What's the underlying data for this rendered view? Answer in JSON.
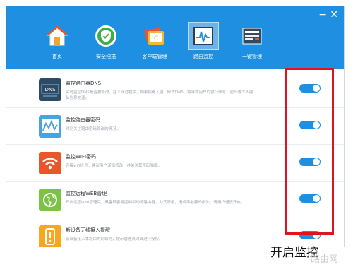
{
  "window_controls": {
    "minimize": "−",
    "close": "✕"
  },
  "nav": [
    {
      "label": "首页",
      "icon": "home-icon"
    },
    {
      "label": "安全扫描",
      "icon": "shield-icon"
    },
    {
      "label": "客户端管理",
      "icon": "client-manage-icon"
    },
    {
      "label": "路由监控",
      "icon": "router-monitor-icon"
    },
    {
      "label": "一键管理",
      "icon": "one-key-manage-icon"
    }
  ],
  "rows": [
    {
      "title": "监控路由器DNS",
      "desc": "实时监控DNS是否被修改，在上网过程中，如果病毒入侵，修改DNS，将导致用户的银行账号、密码等个人隐私信息被盗。",
      "icon_text": "DNS",
      "enabled": true
    },
    {
      "title": "监控路由器密码",
      "desc": "时刻关注路由密码修改的情况。",
      "enabled": true
    },
    {
      "title": "监控WIFI密码",
      "desc": "连接wifi信号，建议用户谨慎修改，并关注其密码强度。",
      "enabled": true
    },
    {
      "title": "监控远程WEB管理",
      "desc": "开启远程web管理后，黑客很容易控制和劫持路由器，为其所用，造成不必要的损失，请用户谨慎开启。",
      "enabled": true
    },
    {
      "title": "新设备无线接入提醒",
      "desc": "新设备接入本路由的网络时，提示管理员对其进行授权。",
      "enabled": true
    }
  ],
  "caption": "开启监控",
  "watermark": "路由网",
  "colors": {
    "accent": "#1e8fe1",
    "highlight": "#e0141e"
  }
}
